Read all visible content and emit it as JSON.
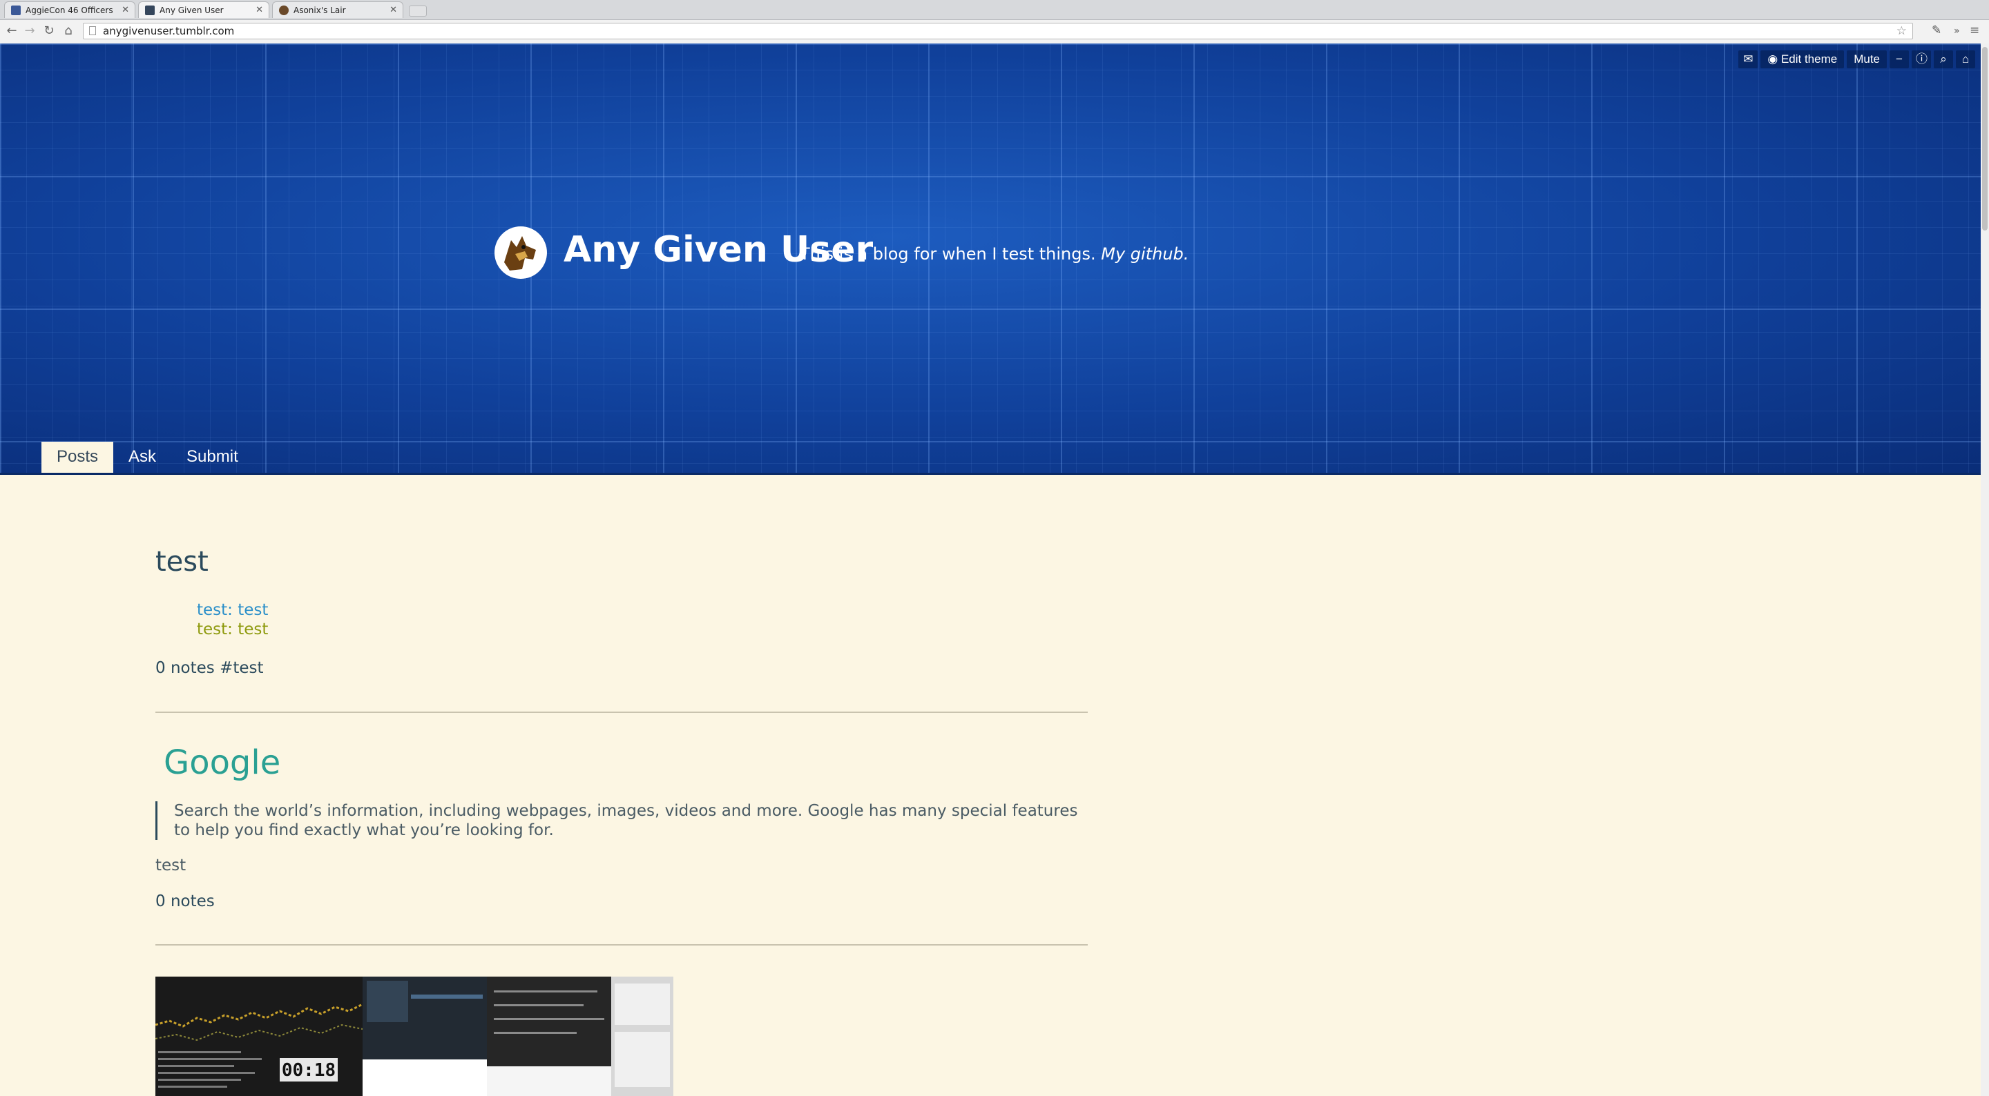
{
  "browser": {
    "tabs": [
      {
        "title": "AggieCon 46 Officers",
        "favicon_color": "#3b5998"
      },
      {
        "title": "Any Given User",
        "favicon_color": "#35465c"
      },
      {
        "title": "Asonix's Lair",
        "favicon_color": "#6b4a2a"
      }
    ],
    "url": "anygivenuser.tumblr.com"
  },
  "blog": {
    "title": "Any Given User",
    "description": "This is a blog for when I test things.",
    "github_link": "My github."
  },
  "controls": {
    "edit_theme": "Edit theme",
    "mute": "Mute"
  },
  "nav": {
    "posts": "Posts",
    "ask": "Ask",
    "submit": "Submit"
  },
  "posts": {
    "chat": {
      "title": "test",
      "lines": [
        {
          "text": "test: test",
          "color": "#2a8fc9"
        },
        {
          "text": "test: test",
          "color": "#8e9a0d"
        }
      ],
      "notes": "0 notes",
      "tag": "#test"
    },
    "link": {
      "title": "Google",
      "quote": "Search the world’s information, including webpages, images, videos and more. Google has many special features to help you find exactly what you’re looking for.",
      "body": "test",
      "notes": "0 notes"
    },
    "photo": {
      "clock": "00:18"
    }
  },
  "colors": {
    "header_blue": "#0f3c8f",
    "background": "#fcf6e3",
    "text_dark": "#2b4a5c",
    "link_teal": "#2aa093"
  }
}
